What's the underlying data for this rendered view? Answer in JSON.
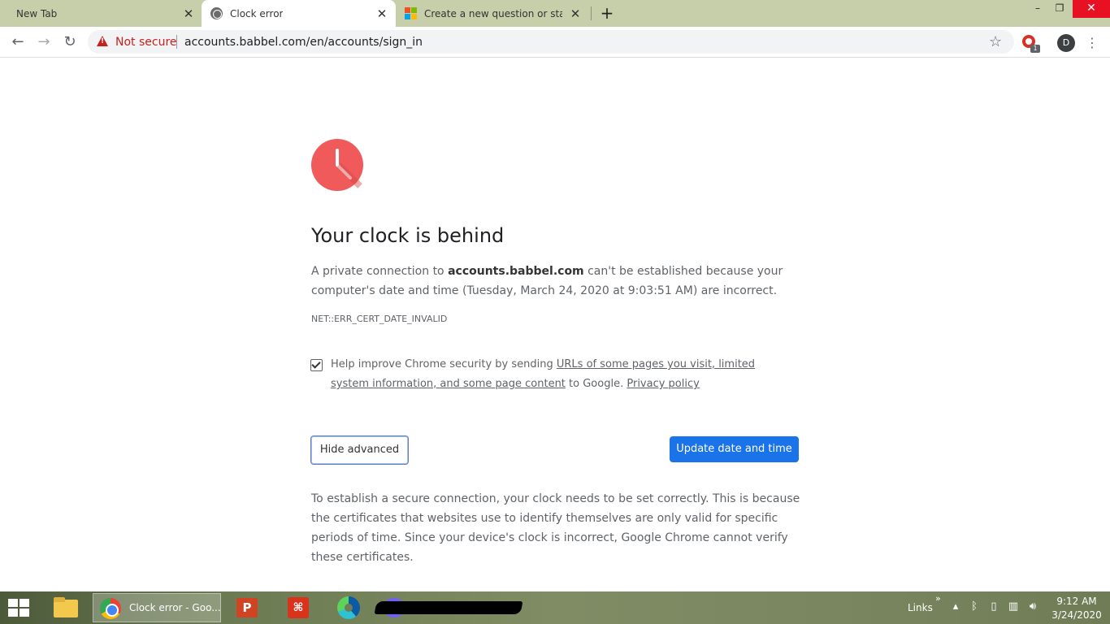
{
  "browser": {
    "tabs": [
      {
        "title": "New Tab"
      },
      {
        "title": "Clock error",
        "active": true
      },
      {
        "title": "Create a new question or start a d"
      }
    ],
    "close_glyph": "✕",
    "new_tab_glyph": "+",
    "window_controls": {
      "minimize": "–",
      "maximize": "❐",
      "close": "✕"
    }
  },
  "toolbar": {
    "security_label": "Not secure",
    "url": "accounts.babbel.com/en/accounts/sign_in",
    "profile_initial": "D",
    "extension_badge": "1"
  },
  "page": {
    "heading": "Your clock is behind",
    "intro_prefix": "A private connection to ",
    "intro_domain": "accounts.babbel.com",
    "intro_suffix": " can't be established because your computer's date and time (Tuesday, March 24, 2020 at 9:03:51 AM) are incorrect.",
    "error_code": "NET::ERR_CERT_DATE_INVALID",
    "optin_prefix": "Help improve Chrome security by sending ",
    "optin_link": "URLs of some pages you visit, limited system information, and some page content",
    "optin_middle": " to Google. ",
    "optin_privacy": "Privacy policy",
    "optin_checked": true,
    "hide_advanced_label": "Hide advanced",
    "update_button_label": "Update date and time",
    "explanation": "To establish a secure connection, your clock needs to be set correctly. This is because the certificates that websites use to identify themselves are only valid for specific periods of time. Since your device's clock is incorrect, Google Chrome cannot verify these certificates."
  },
  "taskbar": {
    "chrome_item_label": "Clock error - Goo...",
    "links_label": "Links",
    "time": "9:12 AM",
    "date": "3/24/2020"
  },
  "colors": {
    "accent": "#1a73e8",
    "warning": "#c5221f",
    "clock_icon": "#f05a5a"
  }
}
